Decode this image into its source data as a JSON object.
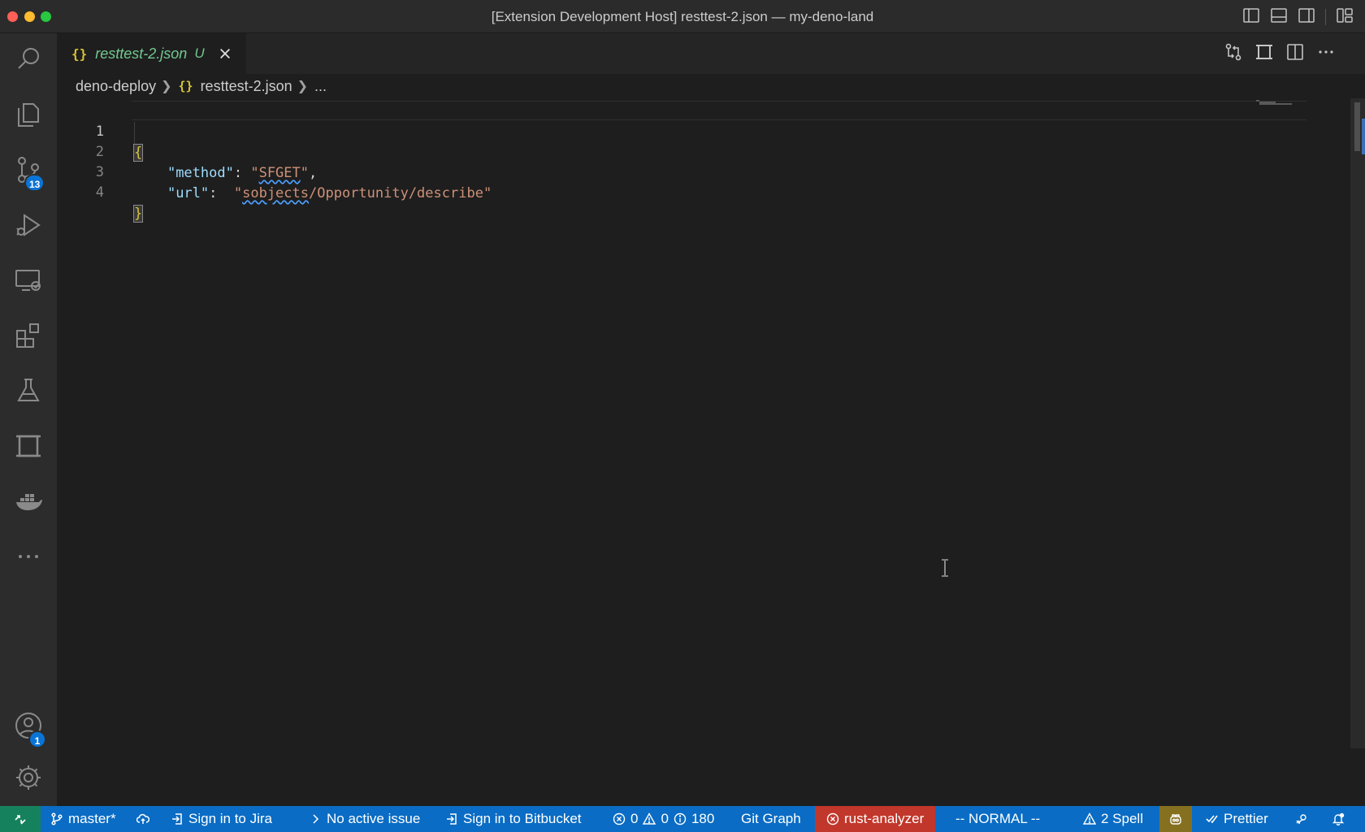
{
  "window": {
    "title": "[Extension Development Host] resttest-2.json — my-deno-land"
  },
  "activity_bar": {
    "items": [
      {
        "name": "search"
      },
      {
        "name": "explorer"
      },
      {
        "name": "source-control",
        "badge": "13"
      },
      {
        "name": "run-and-debug"
      },
      {
        "name": "remote-explorer"
      },
      {
        "name": "extensions"
      },
      {
        "name": "testing"
      },
      {
        "name": "screen"
      },
      {
        "name": "docker"
      },
      {
        "name": "more"
      }
    ],
    "accounts_badge": "1"
  },
  "tab": {
    "icon": "{}",
    "label": "resttest-2.json",
    "status": "U"
  },
  "breadcrumb": {
    "folder": "deno-deploy",
    "file_icon": "{}",
    "file": "resttest-2.json",
    "tail": "..."
  },
  "editor": {
    "lines": [
      {
        "number": "1",
        "open": "{"
      },
      {
        "number": "2",
        "indent": "    ",
        "key": "\"method\"",
        "colon": ": ",
        "value_q1": "\"",
        "value": "SFGET",
        "value_q2": "\"",
        "trail": ","
      },
      {
        "number": "3",
        "indent": "    ",
        "key": "\"url\"",
        "colon": ":  ",
        "value_q1": "\"",
        "value_squiggle": "sobjects",
        "value_rest": "/Opportunity/describe",
        "value_q2": "\""
      },
      {
        "number": "4",
        "close": "}"
      }
    ]
  },
  "statusbar": {
    "branch": "master*",
    "jira": "Sign in to Jira",
    "issue": "No active issue",
    "bitbucket": "Sign in to Bitbucket",
    "errors": "0",
    "warnings": "0",
    "infos": "180",
    "git_graph": "Git Graph",
    "rust": "rust-analyzer",
    "vim_mode": "-- NORMAL --",
    "spell": "2 Spell",
    "prettier": "Prettier"
  },
  "colors": {
    "statusbar": "#0a6cc4",
    "remote": "#16825d",
    "rust_error": "#c2372b",
    "copilot": "#857020",
    "tab_modified": "#73c991",
    "json_icon": "#d7c43b"
  }
}
